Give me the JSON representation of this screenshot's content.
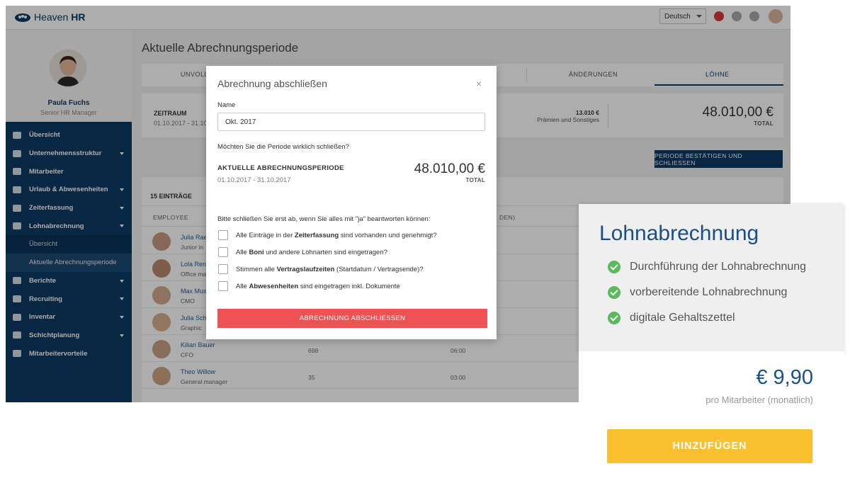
{
  "app": {
    "logo_prefix": "Heaven",
    "logo_suffix": "HR",
    "language": "Deutsch"
  },
  "profile": {
    "name": "Paula Fuchs",
    "role": "Senior HR Manager"
  },
  "sidebar": {
    "items": [
      {
        "label": "Übersicht",
        "icon": "dashboard-icon",
        "expandable": false
      },
      {
        "label": "Unternehmensstruktur",
        "icon": "org-chart-icon",
        "expandable": true
      },
      {
        "label": "Mitarbeiter",
        "icon": "people-icon",
        "expandable": false
      },
      {
        "label": "Urlaub & Abwesenheiten",
        "icon": "beach-umbrella-icon",
        "expandable": true
      },
      {
        "label": "Zeiterfassung",
        "icon": "stopwatch-icon",
        "expandable": true
      },
      {
        "label": "Lohnabrechnung",
        "icon": "wallet-icon",
        "expandable": true
      }
    ],
    "subitems": [
      {
        "label": "Übersicht",
        "active": false
      },
      {
        "label": "Aktuelle Abrechnungsperiode",
        "active": true
      }
    ],
    "items_after": [
      {
        "label": "Berichte",
        "icon": "pie-chart-icon",
        "expandable": true
      },
      {
        "label": "Recruiting",
        "icon": "handshake-icon",
        "expandable": true
      },
      {
        "label": "Inventar",
        "icon": "monitor-icon",
        "expandable": true
      },
      {
        "label": "Schichtplanung",
        "icon": "calendar-icon",
        "expandable": true
      },
      {
        "label": "Mitarbeitervorteile",
        "icon": "shield-icon",
        "expandable": false
      }
    ]
  },
  "page": {
    "title": "Aktuelle Abrechnungsperiode",
    "tabs": [
      {
        "label": "UNVOLLS"
      },
      {
        "label": "ÄNDERUNGEN"
      },
      {
        "label": "LÖHNE"
      }
    ],
    "period_label": "ZEITRAUM",
    "period_dates": "01.10.2017 - 31.10",
    "bonus_amount": "13.010 €",
    "bonus_label": "Prämien und Sonstiges",
    "total_amount": "48.010,00 €",
    "total_label": "TOTAL",
    "confirm_button": "PERIODE BESTÄTIGEN UND SCHLIESSEN",
    "entries_count": "15 EINTRÄGE",
    "column_employee": "EMPLOYEE",
    "column_partial": "DEN)"
  },
  "employees": [
    {
      "name": "Julia Rae",
      "role": "Junior in",
      "col1": "",
      "col2": ""
    },
    {
      "name": "Lola Ren",
      "role": "Office ma",
      "col1": "",
      "col2": ""
    },
    {
      "name": "Max Mus",
      "role": "CMO",
      "col1": "",
      "col2": ""
    },
    {
      "name": "Julia Sch",
      "role": "Graphic",
      "col1": "",
      "col2": ""
    },
    {
      "name": "Kilian Bauer",
      "role": "CFO",
      "col1": "698",
      "col2": "06:00"
    },
    {
      "name": "Theo Willow",
      "role": "General manager",
      "col1": "35",
      "col2": "03:00"
    }
  ],
  "modal": {
    "title": "Abrechnung abschließen",
    "close": "×",
    "name_label": "Name",
    "name_value": "Okt. 2017",
    "question": "Möchten Sie die Periode wirklich schließen?",
    "period_label": "AKTUELLE ABRECHNUNGSPERIODE",
    "period_dates": "01.10.2017 -  31.10.2017",
    "amount": "48.010,00 €",
    "total_label": "TOTAL",
    "instruction": "Bitte schließen Sie erst ab, wenn Sie alles mit \"ja\" beantworten können:",
    "checks": [
      {
        "pre": "Alle Einträge in der ",
        "bold": "Zeiterfassung",
        "post": " sind vorhanden und genehmigt?"
      },
      {
        "pre": "Alle ",
        "bold": "Boni",
        "post": " und andere Lohnarten sind eingetragen?"
      },
      {
        "pre": "Stimmen alle ",
        "bold": "Vertragslaufzeiten",
        "post": " (Startdatum / Vertragsende)?"
      },
      {
        "pre": "Alle ",
        "bold": "Abwesenheiten",
        "post": " sind eingetragen inkl. Dokumente"
      }
    ],
    "submit": "ABRECHNUNG ABSCHLIESSEN"
  },
  "promo": {
    "title": "Lohnabrechnung",
    "features": [
      "Durchführung der Lohnabrechnung",
      "vorbereitende Lohnabrechnung",
      "digitale Gehaltszettel"
    ],
    "price": "€ 9,90",
    "price_note": "pro Mitarbeiter (monatlich)",
    "cta": "HINZUFÜGEN"
  },
  "colors": {
    "brand_navy": "#0d3a63",
    "danger_red": "#ef5253",
    "cta_yellow": "#fbc02d",
    "check_green": "#5cb85c",
    "promo_blue": "#1b4f85"
  }
}
